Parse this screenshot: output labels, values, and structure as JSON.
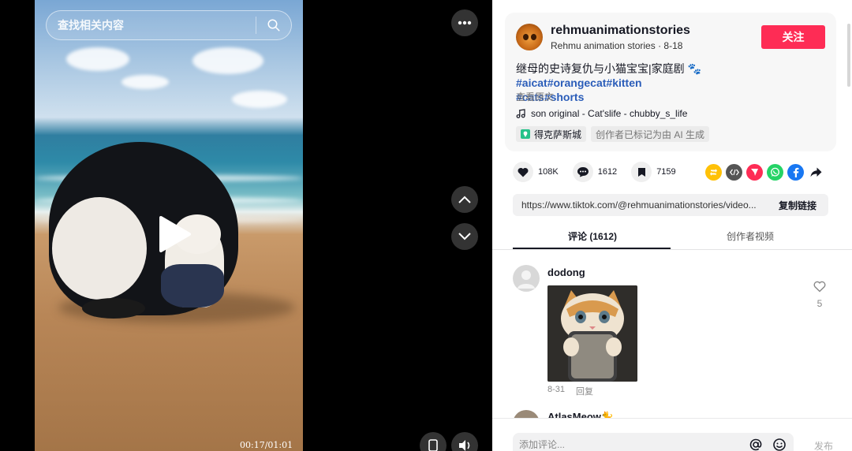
{
  "search": {
    "placeholder": "查找相关内容"
  },
  "video": {
    "timecode": "00:17/01:01",
    "progress": 0.28
  },
  "author": {
    "username": "rehmuanimationstories",
    "display_name": "Rehmu animation stories",
    "date": "8-18",
    "follow_label": "关注"
  },
  "post": {
    "desc_text": "继母的史诗复仇与小猫宝宝|家庭剧",
    "desc_emoji": "🐾",
    "hashtags": [
      "#aicat",
      "#orangecat",
      "#kitten",
      "#cats",
      "#shorts"
    ],
    "see_original": "查看原文",
    "music": "son original - Cat'slife - chubby_s_life",
    "location": "得克萨斯城",
    "ai_label": "创作者已标记为由 AI 生成"
  },
  "stats": {
    "likes": "108K",
    "comments": "1612",
    "saves": "7159"
  },
  "share": {
    "icons": [
      "repost-icon",
      "embed-icon",
      "send-icon",
      "whatsapp-icon",
      "facebook-icon",
      "share-arrow-icon"
    ],
    "colors": {
      "repost": "#ffc107",
      "embed": "#555555",
      "send": "#fe2c55",
      "whatsapp": "#25d366",
      "facebook": "#1877f2"
    }
  },
  "link": {
    "url": "https://www.tiktok.com/@rehmuanimationstories/video...",
    "copy_label": "复制链接"
  },
  "tabs": {
    "comments": "评论 (1612)",
    "creator_videos": "创作者视频"
  },
  "comments": [
    {
      "user": "dodong",
      "date": "8-31",
      "reply": "回复",
      "likes": "5"
    },
    {
      "user": "AtlasMeow🐈"
    }
  ],
  "composer": {
    "placeholder": "添加评论...",
    "post_label": "发布"
  },
  "colors": {
    "accent": "#fe2c55",
    "hashtag": "#2b5db9"
  }
}
